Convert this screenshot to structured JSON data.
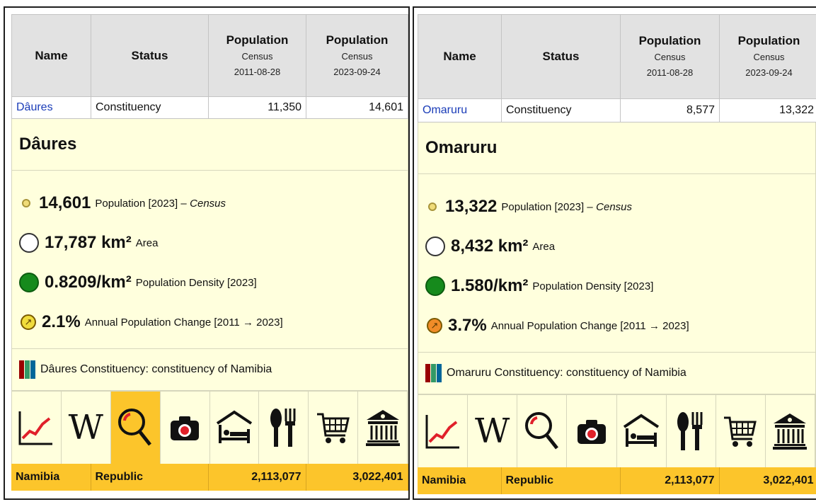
{
  "headers": {
    "name": "Name",
    "status": "Status",
    "population": "Population",
    "census": "Census",
    "date_2011": "2011-08-28",
    "date_2023": "2023-09-24"
  },
  "stat_labels": {
    "population": "Population [2023] –",
    "census": "Census",
    "area_unit": "km²",
    "area": "Area",
    "density_unit": "/km²",
    "density": "Population Density [2023]",
    "change": "Annual Population Change [2011 → 2023]"
  },
  "colors": {
    "accent_yellow": "#fcc52b",
    "panel_yellow": "#ffffdd",
    "header_gray": "#e2e2e2",
    "change_low": "#f0dc3c",
    "change_high": "#f08c28"
  },
  "icons": [
    "chart-icon",
    "wikipedia-icon",
    "search-icon",
    "camera-icon",
    "hotel-icon",
    "restaurant-icon",
    "shopping-cart-icon",
    "museum-icon"
  ],
  "icon_glyphs": {
    "wikipedia": "W",
    "change_arrow": "↗"
  },
  "panels": [
    {
      "name": "Dâures",
      "status": "Constituency",
      "pop_2011": "11,350",
      "pop_2023": "14,601",
      "title": "Dâures",
      "population": "14,601",
      "area": "17,787",
      "density": "0.8209",
      "change": "2.1%",
      "description": "Dâures Constituency: constituency of Namibia",
      "active_icon": "search-icon"
    },
    {
      "name": "Omaruru",
      "status": "Constituency",
      "pop_2011": "8,577",
      "pop_2023": "13,322",
      "title": "Omaruru",
      "population": "13,322",
      "area": "8,432",
      "density": "1.580",
      "change": "3.7%",
      "description": "Omaruru Constituency: constituency of Namibia",
      "active_icon": ""
    }
  ],
  "footer": {
    "country": "Namibia",
    "status": "Republic",
    "pop_2011": "2,113,077",
    "pop_2023": "3,022,401"
  }
}
